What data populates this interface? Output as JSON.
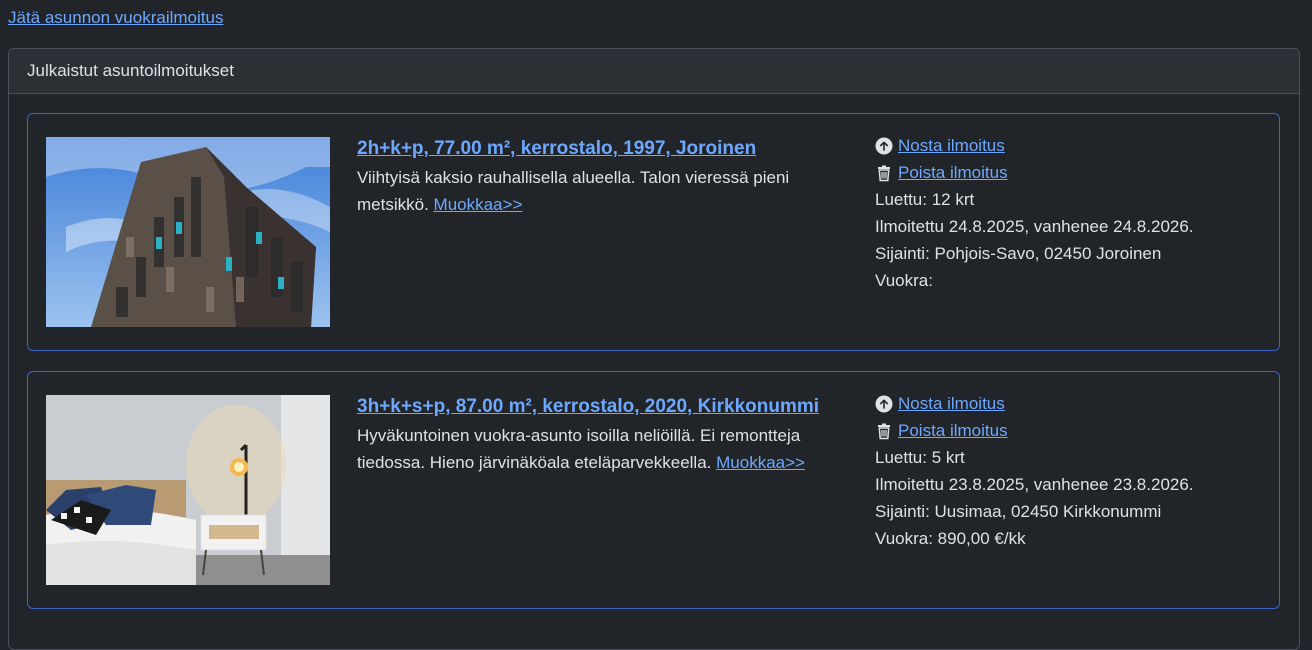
{
  "top_link": "Jätä asunnon vuokrailmoitus",
  "panel_title": "Julkaistut asuntoilmoitukset",
  "listings": [
    {
      "title": "2h+k+p, 77.00 m², kerrostalo, 1997, Joroinen",
      "description": "Viihtyisä kaksio rauhallisella alueella. Talon vieressä pieni metsikkö.",
      "edit_link": "Muokkaa>>",
      "raise_label": "Nosta ilmoitus",
      "delete_label": "Poista ilmoitus",
      "read_count": "Luettu: 12 krt",
      "dates": "Ilmoitettu 24.8.2025, vanhenee 24.8.2026.",
      "location": "Sijainti: Pohjois-Savo, 02450 Joroinen",
      "rent": "Vuokra:",
      "image": "apartment-building-photo"
    },
    {
      "title": "3h+k+s+p, 87.00 m², kerrostalo, 2020, Kirkkonummi",
      "description": "Hyväkuntoinen vuokra-asunto isoilla neliöillä. Ei remontteja tiedossa. Hieno järvinäköala eteläparvekkeella.",
      "edit_link": "Muokkaa>>",
      "raise_label": "Nosta ilmoitus",
      "delete_label": "Poista ilmoitus",
      "read_count": "Luettu: 5 krt",
      "dates": "Ilmoitettu 23.8.2025, vanhenee 23.8.2026.",
      "location": "Sijainti: Uusimaa, 02450 Kirkkonummi",
      "rent": "Vuokra: 890,00 €/kk",
      "image": "bedroom-photo"
    }
  ],
  "icons": {
    "raise": "arrow-up-circle-icon",
    "delete": "trash-icon"
  },
  "colors": {
    "background": "#212529",
    "link": "#6ea8fe",
    "card_border": "#3d63c9",
    "panel_header": "#2b3035"
  }
}
